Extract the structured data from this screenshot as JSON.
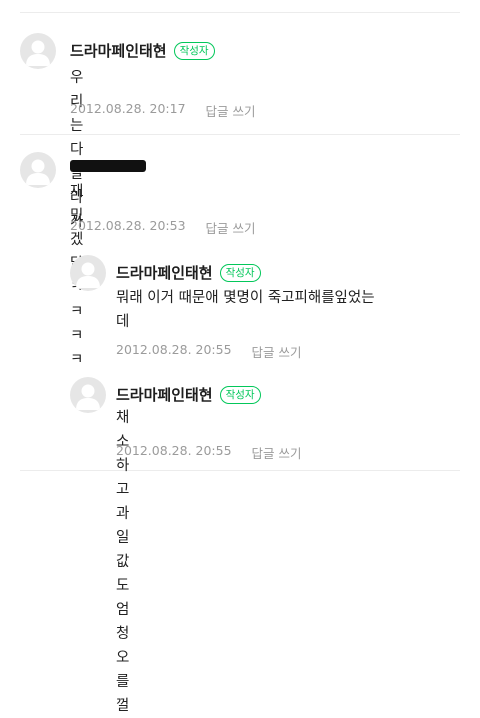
{
  "comments": [
    {
      "author": "드라마페인태현",
      "badge": "작성자",
      "text": "우리는 다 날라가",
      "date": "2012.08.28. 20:17",
      "reply": "답글 쓰기"
    },
    {
      "author": "",
      "text": "재밌겠닭ㅋㅋㅋㅋ",
      "date": "2012.08.28. 20:53",
      "reply": "답글 쓰기"
    },
    {
      "author": "드라마페인태현",
      "badge": "작성자",
      "text": "뭐래 이거 때문애 몇명이 죽고피해를잎었는\n데",
      "date": "2012.08.28. 20:55",
      "reply": "답글 쓰기"
    },
    {
      "author": "드라마페인태현",
      "badge": "작성자",
      "text": "채소하고 과일값도 엄청 오를껄",
      "date": "2012.08.28. 20:55",
      "reply": "답글 쓰기"
    }
  ]
}
